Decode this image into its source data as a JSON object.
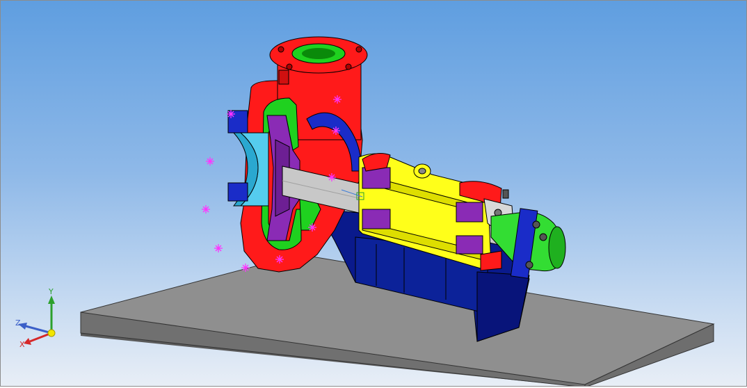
{
  "viewport": {
    "background_top": "#5f9ee0",
    "background_bottom": "#e8eef6"
  },
  "model": {
    "part_colors": {
      "casing": "#ff1a1a",
      "flange_ring": "#1fd11f",
      "suction_cover": "#55ccee",
      "impeller": "#8a2bb5",
      "clamp": "#1a2cc8",
      "bearing_housing": "#ffff1a",
      "shaft": "#c8c8c8",
      "coupling": "#33dd33",
      "pedestal": "#0a1a8c",
      "baseplate": "#8a8a8a"
    },
    "constraint_marker_color": "#ff33ff"
  },
  "triad": {
    "y_label": "Y",
    "z_label": "Z",
    "x_label": "X",
    "y_color": "#2ca02c",
    "z_color": "#3b5fc8",
    "x_color": "#d62728"
  }
}
